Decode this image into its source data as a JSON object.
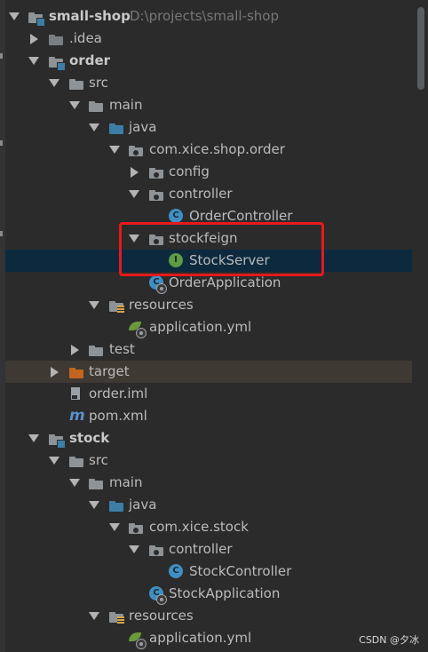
{
  "project_tree": {
    "root": {
      "label": "small-shop",
      "path": "D:\\projects\\small-shop"
    },
    "rows": [
      {
        "label": "small-shop",
        "kind": "module"
      },
      {
        "label": ".idea",
        "kind": "folder"
      },
      {
        "label": "order",
        "kind": "module"
      },
      {
        "label": "src",
        "kind": "folder"
      },
      {
        "label": "main",
        "kind": "folder"
      },
      {
        "label": "java",
        "kind": "source-folder"
      },
      {
        "label": "com.xice.shop.order",
        "kind": "package"
      },
      {
        "label": "config",
        "kind": "package"
      },
      {
        "label": "controller",
        "kind": "package"
      },
      {
        "label": "OrderController",
        "kind": "class"
      },
      {
        "label": "stockfeign",
        "kind": "package"
      },
      {
        "label": "StockServer",
        "kind": "interface"
      },
      {
        "label": "OrderApplication",
        "kind": "spring-boot-class"
      },
      {
        "label": "resources",
        "kind": "resources-folder"
      },
      {
        "label": "application.yml",
        "kind": "spring-config"
      },
      {
        "label": "test",
        "kind": "folder"
      },
      {
        "label": "target",
        "kind": "excluded-folder"
      },
      {
        "label": "order.iml",
        "kind": "iml-file"
      },
      {
        "label": "pom.xml",
        "kind": "maven-file"
      },
      {
        "label": "stock",
        "kind": "module"
      },
      {
        "label": "src",
        "kind": "folder"
      },
      {
        "label": "main",
        "kind": "folder"
      },
      {
        "label": "java",
        "kind": "source-folder"
      },
      {
        "label": "com.xice.stock",
        "kind": "package"
      },
      {
        "label": "controller",
        "kind": "package"
      },
      {
        "label": "StockController",
        "kind": "class"
      },
      {
        "label": "StockApplication",
        "kind": "spring-boot-class"
      },
      {
        "label": "resources",
        "kind": "resources-folder"
      },
      {
        "label": "application.yml",
        "kind": "spring-config"
      }
    ],
    "selected": "StockServer",
    "highlighted": [
      "stockfeign",
      "StockServer"
    ]
  },
  "icons": {
    "class_letter": "C",
    "interface_letter": "I",
    "maven_letter": "m"
  },
  "colors": {
    "background": "#2b2b2b",
    "selection": "#0d293e",
    "excluded_row": "#3e3a33",
    "highlight_box": "#e8191c",
    "source_folder": "#3d7ea6",
    "excluded_folder": "#c3651f",
    "class_icon": "#3f8fc4",
    "interface_icon": "#5d9c46"
  },
  "watermark": "CSDN @夕冰"
}
